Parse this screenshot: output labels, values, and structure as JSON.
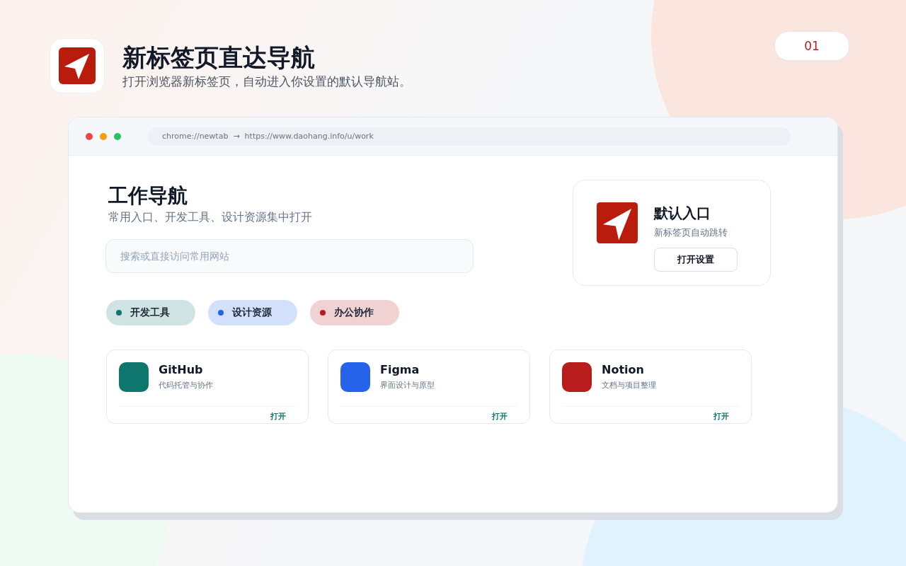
{
  "header": {
    "title": "新标签页直达导航",
    "subtitle": "打开浏览器新标签页，自动进入你设置的默认导航站。",
    "page_badge": "01"
  },
  "browser": {
    "address": "chrome://newtab  →  https://www.daohang.info/u/work",
    "page": {
      "title": "工作导航",
      "subtitle": "常用入口、开发工具、设计资源集中打开",
      "search": {
        "placeholder": "搜索或直接访问常用网站"
      },
      "default_entry": {
        "title": "默认入口",
        "subtitle": "新标签页自动跳转",
        "button": "打开设置"
      },
      "categories": [
        {
          "label": "开发工具",
          "color": "#0f766e"
        },
        {
          "label": "设计资源",
          "color": "#2563eb"
        },
        {
          "label": "办公协作",
          "color": "#b91c1c"
        }
      ],
      "sites": [
        {
          "name": "GitHub",
          "description": "代码托管与协作",
          "action": "打开",
          "color": "#0f766e"
        },
        {
          "name": "Figma",
          "description": "界面设计与原型",
          "action": "打开",
          "color": "#2563eb"
        },
        {
          "name": "Notion",
          "description": "文档与项目整理",
          "action": "打开",
          "color": "#b91c1c"
        }
      ]
    }
  }
}
